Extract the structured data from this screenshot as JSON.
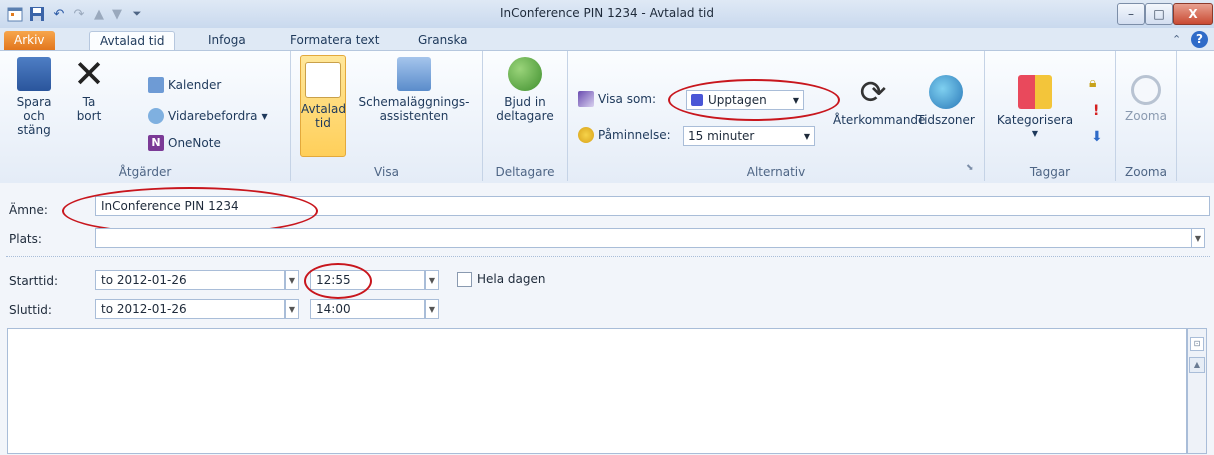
{
  "window": {
    "title": "InConference PIN 1234 - Avtalad tid",
    "minimize": "–",
    "maximize": "□",
    "close": "X",
    "help": "?"
  },
  "tabs": [
    {
      "label": "Arkiv"
    },
    {
      "label": "Avtalad tid"
    },
    {
      "label": "Infoga"
    },
    {
      "label": "Formatera text"
    },
    {
      "label": "Granska"
    }
  ],
  "ribbon": {
    "atgarder": {
      "label": "Åtgärder",
      "save_close": [
        "Spara",
        "och stäng"
      ],
      "delete": [
        "Ta",
        "bort"
      ],
      "calendar": "Kalender",
      "forward": "Vidarebefordra",
      "onenote": "OneNote"
    },
    "visa": {
      "label": "Visa",
      "appointment": [
        "Avtalad",
        "tid"
      ],
      "scheduling": [
        "Schemaläggnings-",
        "assistenten"
      ]
    },
    "deltagare": {
      "label": "Deltagare",
      "invite": [
        "Bjud in",
        "deltagare"
      ]
    },
    "alternativ": {
      "label": "Alternativ",
      "show_as_label": "Visa som:",
      "show_as_value": "Upptagen",
      "reminder_label": "Påminnelse:",
      "reminder_value": "15 minuter",
      "recurrence": "Återkommande",
      "timezones": "Tidszoner"
    },
    "taggar": {
      "label": "Taggar",
      "categorize": "Kategorisera"
    },
    "zooma": {
      "label": "Zooma",
      "zoom": "Zooma"
    }
  },
  "form": {
    "subject_label": "Ämne:",
    "subject_value": "InConference PIN 1234",
    "location_label": "Plats:",
    "location_value": "",
    "start_label": "Starttid:",
    "start_date": "to 2012-01-26",
    "start_time": "12:55",
    "allday_label": "Hela dagen",
    "end_label": "Sluttid:",
    "end_date": "to 2012-01-26",
    "end_time": "14:00"
  },
  "colors": {
    "accent_orange": "#e2761d",
    "annotation_red": "#c8161d",
    "busy_blue": "#4a56d6"
  }
}
